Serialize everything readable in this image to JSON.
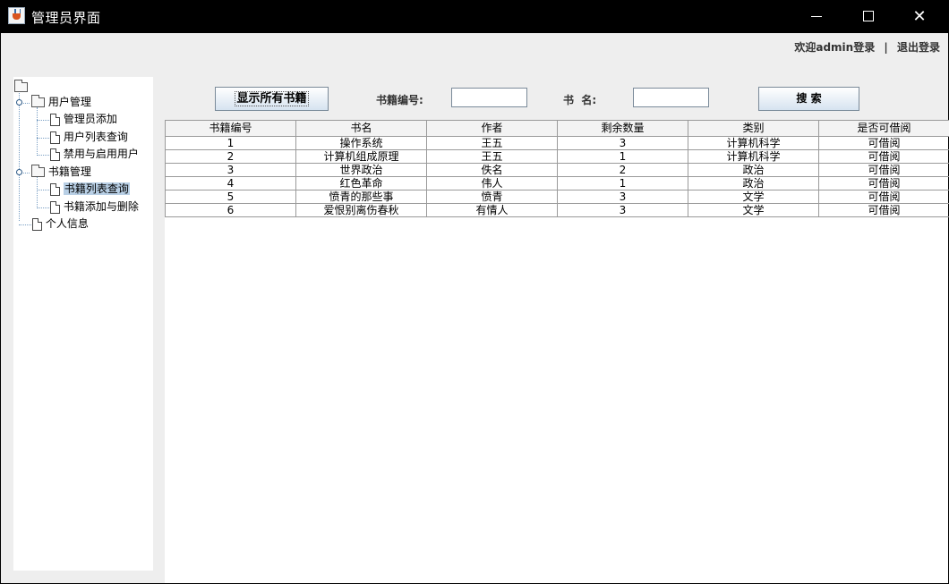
{
  "window": {
    "title": "管理员界面"
  },
  "header": {
    "welcome": "欢迎admin登录",
    "separator": "|",
    "logout": "退出登录"
  },
  "tree": {
    "groups": [
      {
        "label": "用户管理",
        "items": [
          "管理员添加",
          "用户列表查询",
          "禁用与启用用户"
        ]
      },
      {
        "label": "书籍管理",
        "items": [
          "书籍列表查询",
          "书籍添加与删除"
        ]
      }
    ],
    "leaf": "个人信息",
    "selected": "书籍列表查询"
  },
  "search": {
    "show_all_label": "显示所有书籍",
    "book_id_label": "书籍编号:",
    "book_id_value": "",
    "book_name_label": "书  名:",
    "book_name_value": "",
    "search_label": "搜 索"
  },
  "table": {
    "columns": [
      "书籍编号",
      "书名",
      "作者",
      "剩余数量",
      "类别",
      "是否可借阅"
    ],
    "rows": [
      [
        "1",
        "操作系统",
        "王五",
        "3",
        "计算机科学",
        "可借阅"
      ],
      [
        "2",
        "计算机组成原理",
        "王五",
        "1",
        "计算机科学",
        "可借阅"
      ],
      [
        "3",
        "世界政治",
        "佚名",
        "2",
        "政治",
        "可借阅"
      ],
      [
        "4",
        "红色革命",
        "伟人",
        "1",
        "政治",
        "可借阅"
      ],
      [
        "5",
        "愤青的那些事",
        "愤青",
        "3",
        "文学",
        "可借阅"
      ],
      [
        "6",
        "爱恨别离伤春秋",
        "有情人",
        "3",
        "文学",
        "可借阅"
      ]
    ]
  }
}
